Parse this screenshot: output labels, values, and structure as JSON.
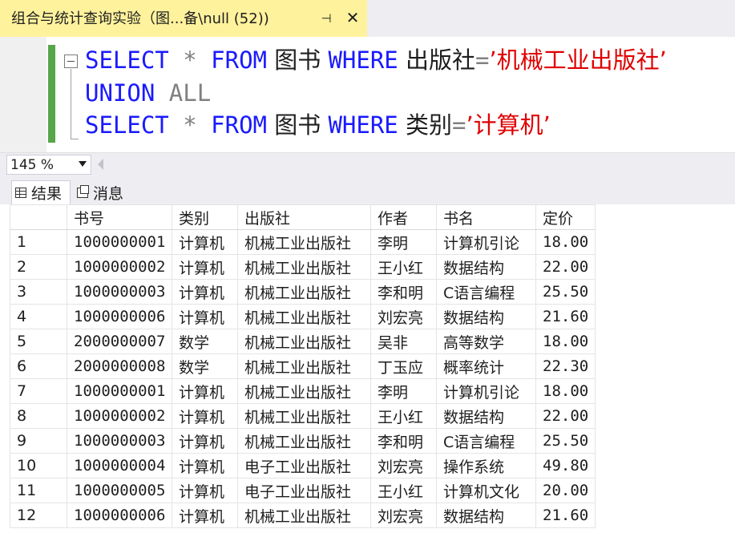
{
  "tab": {
    "title": "组合与统计查询实验（图...备\\null (52))",
    "pin_glyph": "⊣",
    "close_glyph": "✕"
  },
  "editor": {
    "lines": [
      {
        "kw1": "SELECT",
        "op": " * ",
        "kw2": "FROM",
        "table": " 图书 ",
        "kw3": "WHERE",
        "col": " 出版社",
        "eq": "=",
        "str": "’机械工业出版社’"
      },
      {
        "kw1": "UNION",
        "kw2": " ALL"
      },
      {
        "kw1": "SELECT",
        "op": " * ",
        "kw2": "FROM",
        "table": " 图书 ",
        "kw3": "WHERE",
        "col": " 类别",
        "eq": "=",
        "str": "’计算机’"
      }
    ]
  },
  "zoom": {
    "value": "145 %"
  },
  "results_tabs": {
    "results": "结果",
    "messages": "消息"
  },
  "grid": {
    "columns": [
      "书号",
      "类别",
      "出版社",
      "作者",
      "书名",
      "定价"
    ],
    "rows": [
      [
        "1",
        "1000000001",
        "计算机",
        "机械工业出版社",
        "李明",
        "计算机引论",
        "18.00"
      ],
      [
        "2",
        "1000000002",
        "计算机",
        "机械工业出版社",
        "王小红",
        "数据结构",
        "22.00"
      ],
      [
        "3",
        "1000000003",
        "计算机",
        "机械工业出版社",
        "李和明",
        "C语言编程",
        "25.50"
      ],
      [
        "4",
        "1000000006",
        "计算机",
        "机械工业出版社",
        "刘宏亮",
        "数据结构",
        "21.60"
      ],
      [
        "5",
        "2000000007",
        "数学",
        "机械工业出版社",
        "吴非",
        "高等数学",
        "18.00"
      ],
      [
        "6",
        "2000000008",
        "数学",
        "机械工业出版社",
        "丁玉应",
        "概率统计",
        "22.30"
      ],
      [
        "7",
        "1000000001",
        "计算机",
        "机械工业出版社",
        "李明",
        "计算机引论",
        "18.00"
      ],
      [
        "8",
        "1000000002",
        "计算机",
        "机械工业出版社",
        "王小红",
        "数据结构",
        "22.00"
      ],
      [
        "9",
        "1000000003",
        "计算机",
        "机械工业出版社",
        "李和明",
        "C语言编程",
        "25.50"
      ],
      [
        "10",
        "1000000004",
        "计算机",
        "电子工业出版社",
        "刘宏亮",
        "操作系统",
        "49.80"
      ],
      [
        "11",
        "1000000005",
        "计算机",
        "电子工业出版社",
        "王小红",
        "计算机文化",
        "20.00"
      ],
      [
        "12",
        "1000000006",
        "计算机",
        "机械工业出版社",
        "刘宏亮",
        "数据结构",
        "21.60"
      ]
    ]
  }
}
